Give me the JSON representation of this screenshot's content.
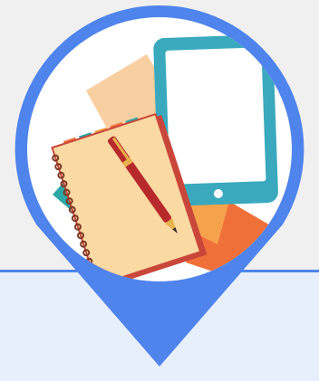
{
  "colors": {
    "background_top": "#f0f0f0",
    "panel_bottom": "#e8effc",
    "accent_blue": "#4f84ec",
    "divider_blue": "#4f84ec",
    "circle_inner": "#ffffff",
    "tablet_teal": "#3aa9bd",
    "paper_peach": "#f8cfa0",
    "paper_teal": "#2ba7a6",
    "paper_orange": "#f0703a",
    "paper_light_orange": "#f6a24d",
    "notebook_page": "#fbd9a3",
    "notebook_cover": "#c9463a",
    "pen_red": "#b8292b",
    "pen_gold": "#e7b24d"
  },
  "icons": {
    "marker": "map-pin-icon",
    "illustration": "notebook-tablet-illustration"
  }
}
